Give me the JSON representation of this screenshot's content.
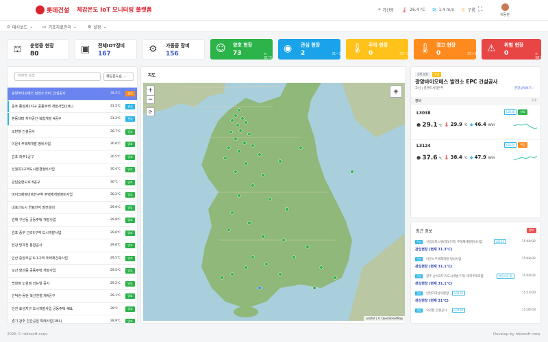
{
  "header": {
    "brand": "롯데건설",
    "title": "체감온도 IoT 모니터링 플랫폼",
    "location": "가산동",
    "temp": "26.4 °C",
    "wind": "1.4 m/s",
    "sky": "구름",
    "user": "이동현"
  },
  "menu": [
    {
      "label": "대시보드"
    },
    {
      "label": "기초자료관리"
    },
    {
      "label": "설정"
    }
  ],
  "stats": [
    {
      "label": "운영중 현장",
      "value": "80"
    },
    {
      "label": "전체IOT장비",
      "value": "167"
    },
    {
      "label": "가동중 장비",
      "value": "156"
    }
  ],
  "status": [
    {
      "label": "양호 현장",
      "value": "73",
      "range": "≤ 31°C",
      "color": "#2cb34a"
    },
    {
      "label": "관심 현장",
      "value": "2",
      "range": "31~32.9°C",
      "color": "#1aa3e8"
    },
    {
      "label": "주의 현장",
      "value": "0",
      "range": "33~34.9°C",
      "color": "#ffc21a"
    },
    {
      "label": "경고 현장",
      "value": "0",
      "range": "35~37.9°C",
      "color": "#ff8b1f"
    },
    {
      "label": "위험 현장",
      "value": "0",
      "range": "≥ 38°C",
      "color": "#e84545"
    }
  ],
  "search": {
    "placeholder": "현장명 검색",
    "sort": "체감온도순"
  },
  "sites": [
    {
      "name": "광양바이오메스 발전소 EPC 건설공사",
      "temp": "38.3℃",
      "badge": "관심"
    },
    {
      "name": "운주 종암제1지구 공동주택 개발사업(1BL)",
      "temp": "31.5℃",
      "badge": "관심"
    },
    {
      "name": "판동대파 지하공간 복합개발 4공구",
      "temp": "31.3℃",
      "badge": "관심"
    },
    {
      "name": "오만철 건설공사",
      "temp": "30.7℃",
      "badge": "양호"
    },
    {
      "name": "이문4 주택재개발 정비사업",
      "temp": "30.6℃",
      "badge": "양호"
    },
    {
      "name": "김포-파주1공구",
      "temp": "30.5℃",
      "badge": "양호"
    },
    {
      "name": "신월곡1구역도시환경정비사업",
      "temp": "30.4℃",
      "badge": "양호"
    },
    {
      "name": "강남순환도로 8공구",
      "temp": "30℃",
      "badge": "양호"
    },
    {
      "name": "마이크제정비촉진구역 주택재개발정비사업",
      "temp": "30.2℃",
      "badge": "양호"
    },
    {
      "name": "내포신도시 연료전지 발전설비",
      "temp": "29.9℃",
      "badge": "양호"
    },
    {
      "name": "김해 구산동 공동주택 개발사업",
      "temp": "29.8℃",
      "badge": "양호"
    },
    {
      "name": "김포 풍무 근리5구역 도시개발사업",
      "temp": "29.6℃",
      "badge": "양호"
    },
    {
      "name": "한강 망과천 통합공사",
      "temp": "29.6℃",
      "badge": "양호"
    },
    {
      "name": "인산 중앙주공 6-1구역 주택재건축사업",
      "temp": "29.5℃",
      "badge": "양호"
    },
    {
      "name": "오산 양산동 공동주택 개발사업",
      "temp": "29.5℃",
      "badge": "양호"
    },
    {
      "name": "백화점 노원점 리뉴얼 공사",
      "temp": "29.2℃",
      "badge": "양호"
    },
    {
      "name": "인덕원-동탄 복선전철 제4공구",
      "temp": "29.1℃",
      "badge": "양호"
    },
    {
      "name": "인천 효성지구 도시개발사업 공동주택 4BL",
      "temp": "29℃",
      "badge": "양호"
    },
    {
      "name": "경기 광주 민간공원 특례사업(1BL)",
      "temp": "28.9℃",
      "badge": "양호"
    }
  ],
  "map": {
    "title": "지도",
    "zoom_in": "+",
    "zoom_out": "−",
    "attribution": "Leaflet | © OpenStreetMap"
  },
  "detail": {
    "tag1": "선택 현장",
    "tag2": "관심",
    "site": "광양바이오메스 발전소 EPC 건설공사",
    "sub": "호남 | 플랜트사업본부",
    "link": "현장상세보기 ›",
    "eq_label": "장비",
    "eq_count": "2대",
    "equipment": [
      {
        "id": "L3038",
        "chip1": "L3038",
        "chip2": "양호",
        "feel": "29.1",
        "temp": "29.9",
        "hum": "46.4"
      },
      {
        "id": "L3124",
        "chip1": "L3124",
        "chip2": "관심",
        "feel": "37.6",
        "temp": "38.4",
        "hum": "47.9"
      }
    ]
  },
  "alerts": {
    "title": "최근 경보",
    "badge": "경보",
    "items": [
      {
        "b": "관심",
        "t": "신림오피스텔(제1구역) 주택재개발정비사업",
        "ch": "L3154",
        "msg": "관심현장 (현재 31.3°C)",
        "tm": "15:48:02"
      },
      {
        "b": "관심",
        "t": "이문4 주택재개발 정비사업",
        "ch": "",
        "msg": "관심현장 (현재 31.1°C)",
        "tm": "15:48:02"
      },
      {
        "b": "관심",
        "t": "광주 상서3지구(도시개발구역) 대학주택조합",
        "ch": "현장시공 중",
        "msg": "관심현장 (현재 31.1°C)",
        "tm": "15:40:02"
      },
      {
        "b": "관심",
        "t": "인천다대남북합정",
        "ch": "L3115",
        "msg": "관심현장 (현재 31°C)",
        "tm": "15:10:00"
      },
      {
        "b": "관심",
        "t": "오란철 건설공사",
        "ch": "L3100",
        "msg": "",
        "tm": "15:00:03"
      }
    ]
  },
  "footer": {
    "left": "2026 © nblzsoft corp.",
    "right": "Develop by nblzsoft corp."
  }
}
